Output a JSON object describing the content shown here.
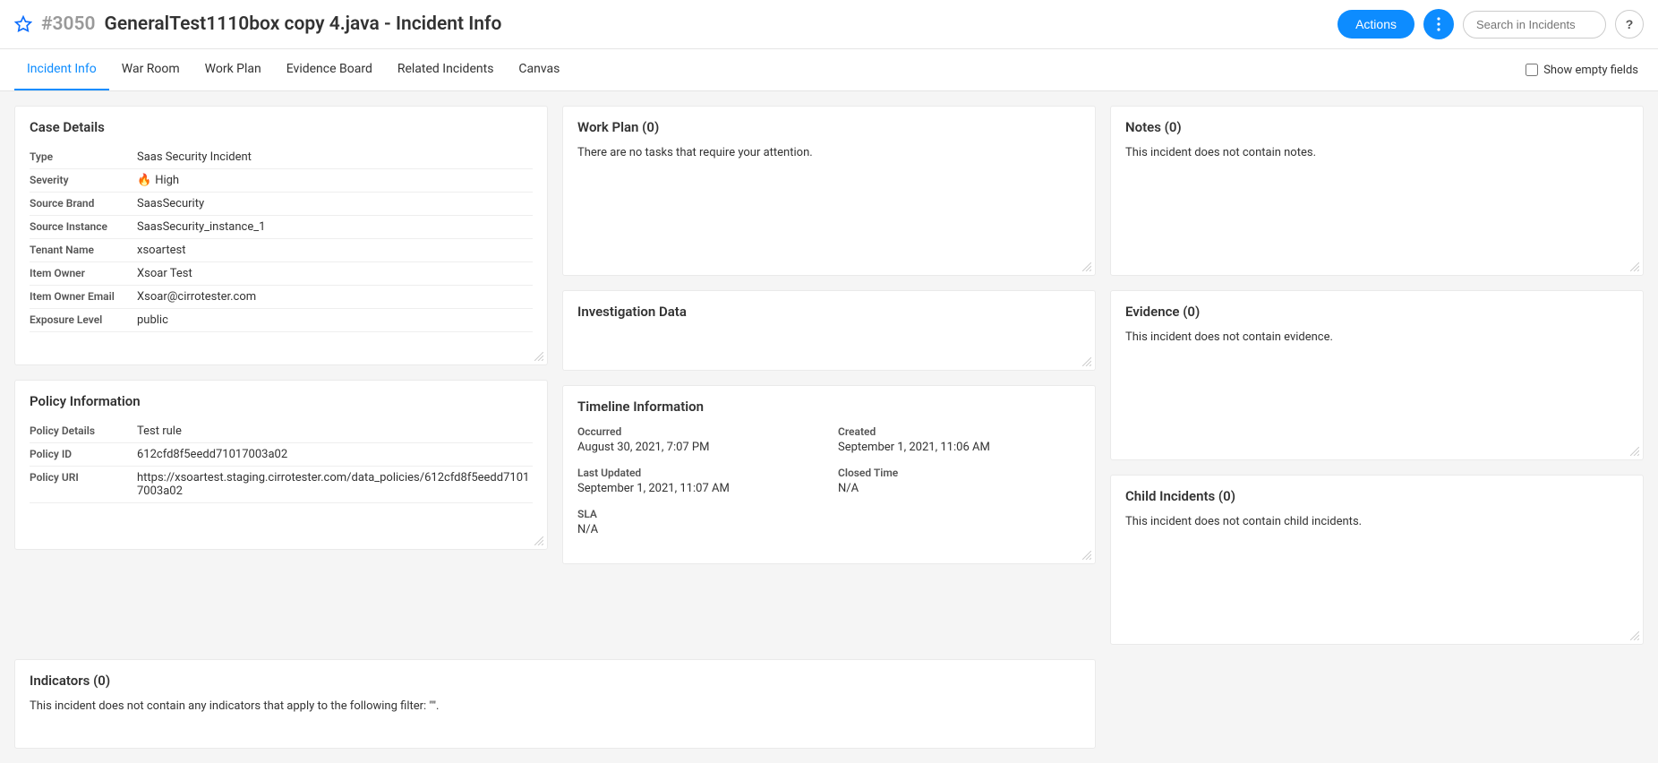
{
  "header": {
    "incident_id": "#3050",
    "title": "GeneralTest1110box copy 4.java - Incident Info",
    "actions_label": "Actions",
    "search_placeholder": "Search in Incidents",
    "help_label": "?"
  },
  "tabs": {
    "items": [
      "Incident Info",
      "War Room",
      "Work Plan",
      "Evidence Board",
      "Related Incidents",
      "Canvas"
    ],
    "active": 0,
    "show_empty_label": "Show empty fields"
  },
  "case_details": {
    "title": "Case Details",
    "rows": [
      {
        "label": "Type",
        "value": "Saas Security Incident"
      },
      {
        "label": "Severity",
        "value": "High",
        "severity": true
      },
      {
        "label": "Source Brand",
        "value": "SaasSecurity"
      },
      {
        "label": "Source Instance",
        "value": "SaasSecurity_instance_1"
      },
      {
        "label": "Tenant Name",
        "value": "xsoartest"
      },
      {
        "label": "Item Owner",
        "value": "Xsoar Test"
      },
      {
        "label": "Item Owner Email",
        "value": "Xsoar@cirrotester.com"
      },
      {
        "label": "Exposure Level",
        "value": "public"
      }
    ]
  },
  "policy": {
    "title": "Policy Information",
    "rows": [
      {
        "label": "Policy Details",
        "value": "Test rule"
      },
      {
        "label": "Policy ID",
        "value": "612cfd8f5eedd71017003a02"
      },
      {
        "label": "Policy URI",
        "value": "https://xsoartest.staging.cirrotester.com/data_policies/612cfd8f5eedd71017003a02"
      }
    ]
  },
  "work_plan": {
    "title": "Work Plan (0)",
    "empty": "There are no tasks that require your attention."
  },
  "investigation": {
    "title": "Investigation Data"
  },
  "timeline": {
    "title": "Timeline Information",
    "items": [
      {
        "label": "Occurred",
        "value": "August 30, 2021, 7:07 PM"
      },
      {
        "label": "Created",
        "value": "September 1, 2021, 11:06 AM"
      },
      {
        "label": "Last Updated",
        "value": "September 1, 2021, 11:07 AM"
      },
      {
        "label": "Closed Time",
        "value": "N/A"
      },
      {
        "label": "SLA",
        "value": "N/A"
      }
    ]
  },
  "notes": {
    "title": "Notes (0)",
    "empty": "This incident does not contain notes."
  },
  "evidence": {
    "title": "Evidence (0)",
    "empty": "This incident does not contain evidence."
  },
  "child": {
    "title": "Child Incidents (0)",
    "empty": "This incident does not contain child incidents."
  },
  "indicators": {
    "title": "Indicators (0)",
    "empty": "This incident does not contain any indicators that apply to the following filter: \"\"."
  }
}
